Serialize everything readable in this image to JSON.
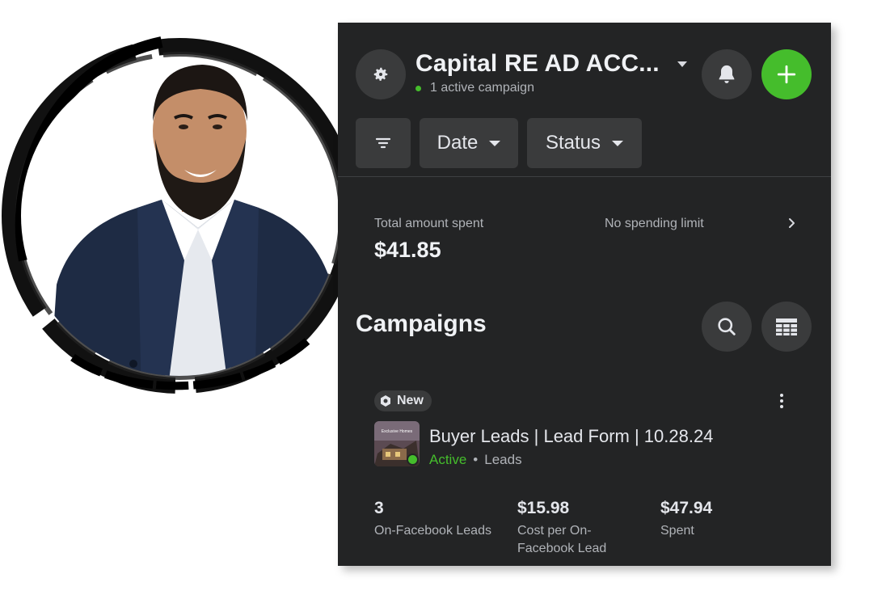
{
  "header": {
    "account_name": "Capital RE AD ACC...",
    "active_campaigns": "1 active campaign",
    "settings_icon": "gear-icon",
    "notifications_icon": "bell-icon",
    "add_icon": "plus-icon"
  },
  "filters": {
    "filter_icon": "filter-icon",
    "date_label": "Date",
    "status_label": "Status"
  },
  "spend": {
    "label": "Total amount spent",
    "value": "$41.85",
    "limit_label": "No spending limit"
  },
  "campaigns": {
    "title": "Campaigns",
    "search_icon": "search-icon",
    "table_icon": "table-icon",
    "items": [
      {
        "badge": "New",
        "name": "Buyer Leads | Lead Form | 10.28.24",
        "status": "Active",
        "separator": "•",
        "objective": "Leads",
        "thumbnail_text": "Exclusive Homes",
        "metrics": [
          {
            "value": "3",
            "label": "On-Facebook Leads"
          },
          {
            "value": "$15.98",
            "label": "Cost per On-Facebook Lead"
          },
          {
            "value": "$47.94",
            "label": "Spent"
          }
        ]
      }
    ]
  },
  "colors": {
    "panel_bg": "#232425",
    "button_bg": "#3a3b3c",
    "accent_green": "#45bd2c",
    "text_primary": "#e4e6eb",
    "text_secondary": "#b0b3b8"
  }
}
